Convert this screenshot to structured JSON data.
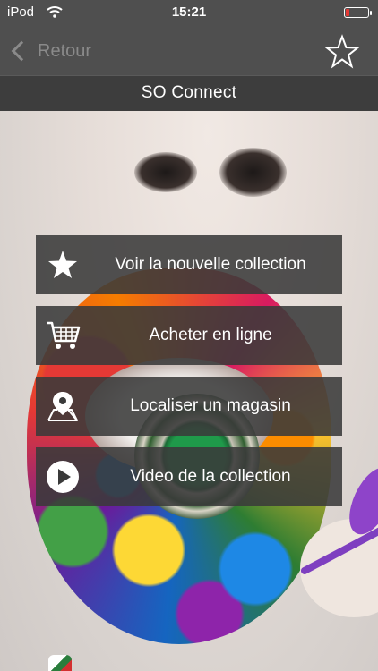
{
  "status_bar": {
    "carrier": "iPod",
    "time": "15:21",
    "battery_level": 0.15,
    "battery_color": "#e53935"
  },
  "nav": {
    "back_label": "Retour",
    "favorite_icon": "star-outline-icon"
  },
  "title": "SO Connect",
  "menu": [
    {
      "label": "Voir la nouvelle collection",
      "icon": "star-icon"
    },
    {
      "label": "Acheter en ligne",
      "icon": "shopping-cart-icon"
    },
    {
      "label": "Localiser un magasin",
      "icon": "map-pin-icon"
    },
    {
      "label": "Video de la collection",
      "icon": "play-icon"
    }
  ],
  "colors": {
    "nav_background": "#4f4f4f",
    "title_background": "#3d3d3d",
    "button_background": "#3a3a3a"
  }
}
